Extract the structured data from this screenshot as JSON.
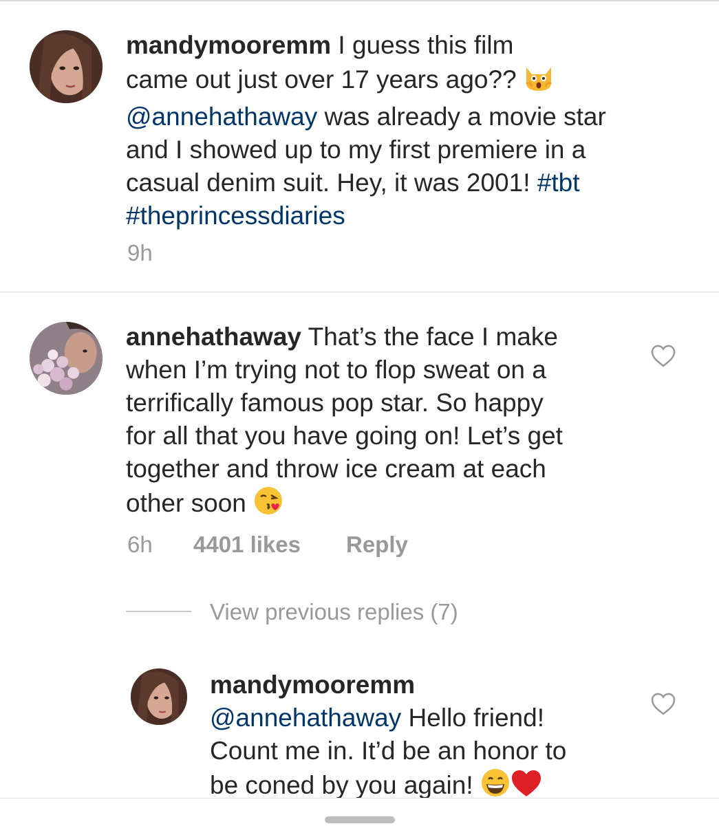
{
  "caption": {
    "username": "mandymooremm",
    "text_1": " I guess this film",
    "text_2": "came out just over 17 years ago?? ",
    "emoji": "scream-cat",
    "mention": "@annehathaway",
    "text_3": " was already a movie star",
    "text_4": "and I showed up to my first premiere in a",
    "text_5": "casual denim suit. Hey, it was 2001! ",
    "tag_1": "#tbt",
    "tag_2": "#theprincessdiaries",
    "time": "9h"
  },
  "comment": {
    "username": "annehathaway",
    "line_1": " That’s the face I make",
    "line_2": "when I’m trying not to flop sweat on a",
    "line_3": "terrifically famous pop star.  So happy",
    "line_4": "for all that you have going on!  Let’s get",
    "line_5": "together and throw ice cream at each",
    "line_6": "other soon ",
    "emoji": "kissing-face",
    "time": "6h",
    "likes": "4401 likes",
    "reply_label": "Reply"
  },
  "replies": {
    "view_previous": "View previous replies (7)"
  },
  "reply": {
    "username": "mandymooremm",
    "mention": "@annehathaway",
    "text_1": " Hello friend!",
    "text_2": "Count me in. It’d be an honor to",
    "text_3": "be coned by you again! ",
    "emojis": [
      "grinning-face",
      "red-heart"
    ]
  },
  "colors": {
    "link": "#003569",
    "text": "#262626",
    "muted": "#999999",
    "divider": "#dbdbdb"
  }
}
